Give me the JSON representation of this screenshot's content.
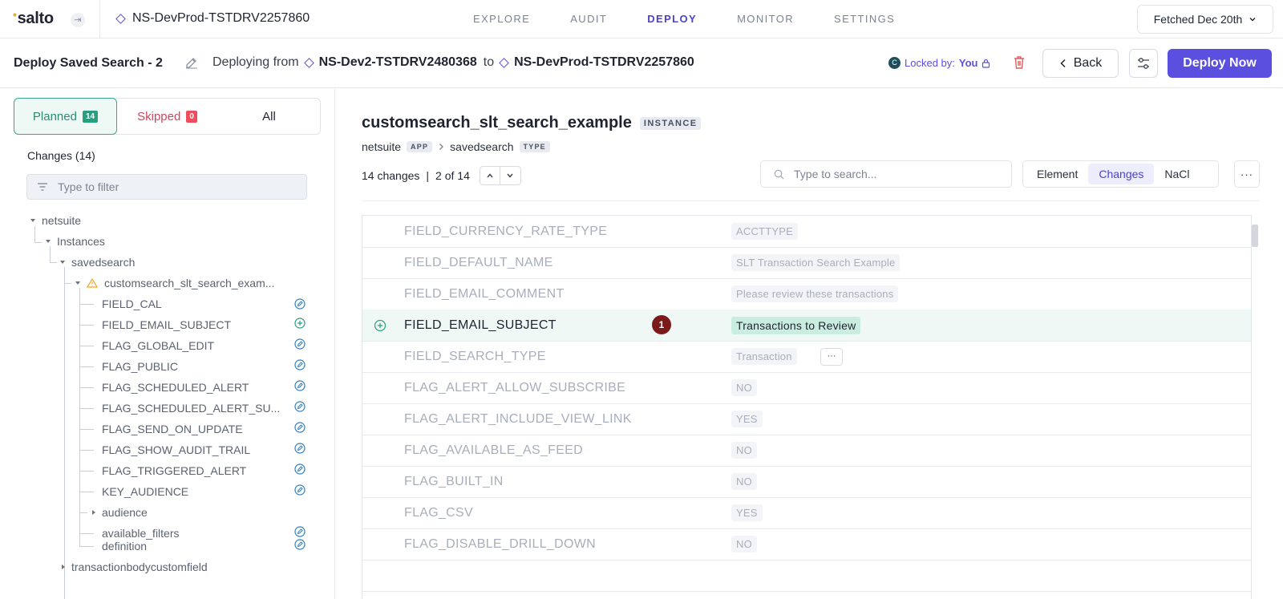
{
  "app": {
    "logo": "salto"
  },
  "topbar": {
    "env_name": "NS-DevProd-TSTDRV2257860",
    "nav": [
      "EXPLORE",
      "AUDIT",
      "DEPLOY",
      "MONITOR",
      "SETTINGS"
    ],
    "active_nav": "DEPLOY",
    "fetched": "Fetched Dec 20th"
  },
  "subbar": {
    "deploy_name": "Deploy Saved Search - 2",
    "from_label": "Deploying from",
    "source_env": "NS-Dev2-TSTDRV2480368",
    "to_label": "to",
    "target_env": "NS-DevProd-TSTDRV2257860",
    "avatar_letter": "C",
    "locked_label": "Locked by:",
    "locked_user": "You",
    "back_label": "Back",
    "deploy_label": "Deploy Now"
  },
  "left": {
    "tabs": {
      "planned": "Planned",
      "planned_count": "14",
      "skipped": "Skipped",
      "skipped_count": "0",
      "all": "All"
    },
    "changes_title": "Changes (14)",
    "filter_placeholder": "Type to filter",
    "tree": {
      "netsuite": "netsuite",
      "instances": "Instances",
      "savedsearch": "savedsearch",
      "instance": "customsearch_slt_search_exam...",
      "fields": [
        {
          "name": "FIELD_CAL",
          "status": "modify"
        },
        {
          "name": "FIELD_EMAIL_SUBJECT",
          "status": "add"
        },
        {
          "name": "FLAG_GLOBAL_EDIT",
          "status": "modify"
        },
        {
          "name": "FLAG_PUBLIC",
          "status": "modify"
        },
        {
          "name": "FLAG_SCHEDULED_ALERT",
          "status": "modify"
        },
        {
          "name": "FLAG_SCHEDULED_ALERT_SU...",
          "status": "modify"
        },
        {
          "name": "FLAG_SEND_ON_UPDATE",
          "status": "modify"
        },
        {
          "name": "FLAG_SHOW_AUDIT_TRAIL",
          "status": "modify"
        },
        {
          "name": "FLAG_TRIGGERED_ALERT",
          "status": "modify"
        },
        {
          "name": "KEY_AUDIENCE",
          "status": "modify"
        }
      ],
      "audience": "audience",
      "available_filters": "available_filters",
      "definition": "definition",
      "transactionbodycustomfield": "transactionbodycustomfield"
    }
  },
  "main": {
    "element_title": "customsearch_slt_search_example",
    "element_tag": "INSTANCE",
    "crumb_app": "netsuite",
    "crumb_app_tag": "APP",
    "crumb_type": "savedsearch",
    "crumb_type_tag": "TYPE",
    "changes_count": "14 changes",
    "position": "2 of 14",
    "search_placeholder": "Type to search...",
    "views": [
      "Element",
      "Changes",
      "NaCl"
    ],
    "active_view": "Changes",
    "rows": [
      {
        "key": "FIELD_CURRENCY_RATE_TYPE",
        "value": "ACCTTYPE"
      },
      {
        "key": "FIELD_DEFAULT_NAME",
        "value": "SLT Transaction Search Example"
      },
      {
        "key": "FIELD_EMAIL_COMMENT",
        "value": "Please review these transactions"
      },
      {
        "key": "FIELD_EMAIL_SUBJECT",
        "value": "Transactions to Review",
        "highlight": true,
        "marker": "1"
      },
      {
        "key": "FIELD_SEARCH_TYPE",
        "value": "Transaction",
        "more": "···"
      },
      {
        "key": "FLAG_ALERT_ALLOW_SUBSCRIBE",
        "value": "NO"
      },
      {
        "key": "FLAG_ALERT_INCLUDE_VIEW_LINK",
        "value": "YES"
      },
      {
        "key": "FLAG_AVAILABLE_AS_FEED",
        "value": "NO"
      },
      {
        "key": "FLAG_BUILT_IN",
        "value": "NO"
      },
      {
        "key": "FLAG_CSV",
        "value": "YES"
      },
      {
        "key": "FLAG_DISABLE_DRILL_DOWN",
        "value": "NO"
      },
      {
        "key": "",
        "value": ""
      }
    ]
  },
  "colors": {
    "accent": "#5b4fe0",
    "add": "#2a9d7e",
    "modify": "#2f7fc4",
    "danger": "#ef4c5d"
  }
}
